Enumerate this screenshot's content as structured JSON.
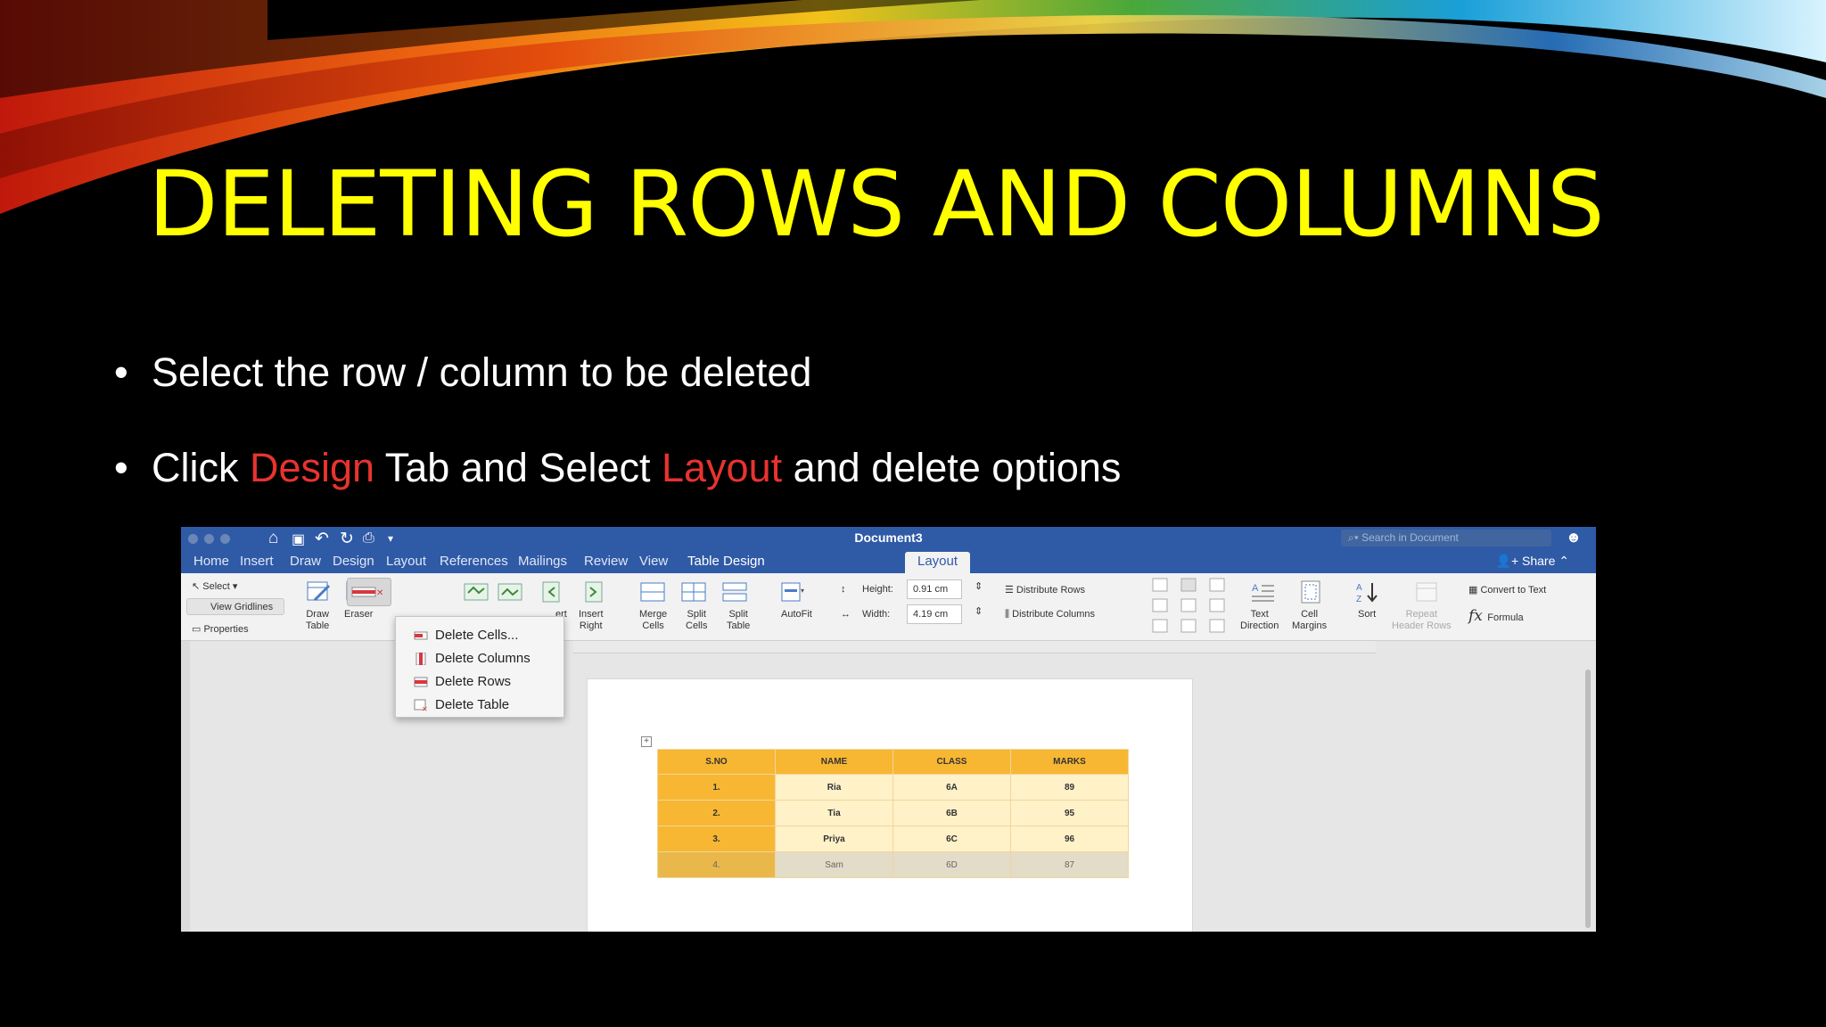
{
  "slide": {
    "title": "DELETING ROWS AND COLUMNS",
    "bullets": [
      {
        "text_before": "Select the row / column to be deleted",
        "hl1": "",
        "mid": "",
        "hl2": "",
        "after": ""
      },
      {
        "text_before": "Click ",
        "hl1": "Design",
        "mid": " Tab and Select ",
        "hl2": "Layout",
        "after": " and delete options"
      }
    ],
    "bullet_glyph": "•",
    "highlight_color": "#e8332e",
    "title_color": "#ffff00"
  },
  "word": {
    "doc_title": "Document3",
    "search_placeholder": "Search in Document",
    "share": "Share",
    "tabs": [
      "Home",
      "Insert",
      "Draw",
      "Design",
      "Layout",
      "References",
      "Mailings",
      "Review",
      "View",
      "Table Design",
      "Layout"
    ],
    "ribbon": {
      "select": "Select",
      "view_gridlines": "View Gridlines",
      "properties": "Properties",
      "draw_table": "Draw\nTable",
      "eraser": "Eraser",
      "insert_left": "ert\nft",
      "insert_right": "Insert\nRight",
      "merge_cells": "Merge\nCells",
      "split_cells": "Split\nCells",
      "split_table": "Split\nTable",
      "autofit": "AutoFit",
      "height_label": "Height:",
      "height_value": "0.91 cm",
      "width_label": "Width:",
      "width_value": "4.19 cm",
      "distribute_rows": "Distribute Rows",
      "distribute_columns": "Distribute Columns",
      "text_direction": "Text\nDirection",
      "cell_margins": "Cell\nMargins",
      "sort": "Sort",
      "repeat_header_rows": "Repeat\nHeader Rows",
      "convert_to_text": "Convert to Text",
      "formula": "Formula"
    },
    "delete_menu": [
      "Delete Cells...",
      "Delete Columns",
      "Delete Rows",
      "Delete Table"
    ],
    "table": {
      "headers": [
        "S.NO",
        "NAME",
        "CLASS",
        "MARKS"
      ],
      "rows": [
        [
          "1.",
          "Ria",
          "6A",
          "89"
        ],
        [
          "2.",
          "Tia",
          "6B",
          "95"
        ],
        [
          "3.",
          "Priya",
          "6C",
          "96"
        ],
        [
          "4.",
          "Sam",
          "6D",
          "87"
        ]
      ]
    }
  }
}
